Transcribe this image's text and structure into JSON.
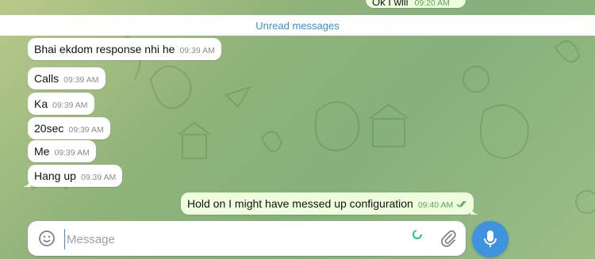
{
  "top_partial": {
    "text": "Ok I will",
    "time": "09:20 AM"
  },
  "unread_label": "Unread messages",
  "incoming": [
    {
      "text": "Bhai ekdom response nhi he",
      "time": "09:39 AM"
    },
    {
      "text": "Calls",
      "time": "09:39 AM"
    },
    {
      "text": "Ka",
      "time": "09:39 AM"
    },
    {
      "text": "20sec",
      "time": "09:39 AM"
    },
    {
      "text": "Me",
      "time": "09:39 AM"
    },
    {
      "text": "Hang up",
      "time": "09:39 AM"
    }
  ],
  "outgoing": {
    "text": "Hold on I might have messed up configuration",
    "time": "09:40 AM",
    "status_icon": "double-check-icon"
  },
  "composer": {
    "placeholder": "Message",
    "emoji_icon": "emoji-icon",
    "attach_icon": "paperclip-icon",
    "mic_icon": "microphone-icon"
  },
  "colors": {
    "accent": "#3f93de",
    "outgoing_bubble": "#effedd",
    "link": "#3a8fd0"
  }
}
